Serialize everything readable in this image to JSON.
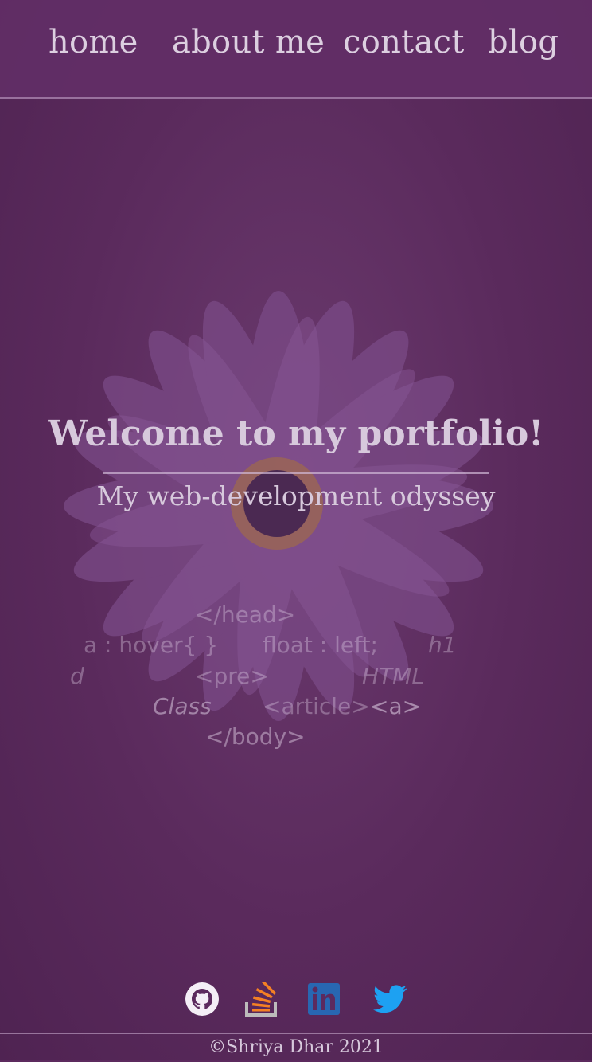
{
  "nav": {
    "items": [
      {
        "label": "home"
      },
      {
        "label": "about me"
      },
      {
        "label": "contact"
      },
      {
        "label": "blog"
      }
    ]
  },
  "hero": {
    "title": "Welcome to my portfolio!",
    "subtitle": "My web-development odyssey"
  },
  "background_code": [
    "</head>",
    "a : hover{ }",
    "float : left;",
    "h1",
    "<pre>",
    "HTML",
    "d",
    "Class",
    "<article>",
    "<a>",
    "</body>"
  ],
  "social": [
    {
      "icon": "github-icon"
    },
    {
      "icon": "stackoverflow-icon"
    },
    {
      "icon": "linkedin-icon"
    },
    {
      "icon": "twitter-icon"
    }
  ],
  "footer": {
    "text": "©Shriya Dhar 2021"
  },
  "colors": {
    "background": "#5c2a5e",
    "nav_background": "#622e66",
    "text": "#dccfe0",
    "linkedin": "#2867b2",
    "twitter": "#1da1f2",
    "stackoverflow": "#f48024"
  }
}
